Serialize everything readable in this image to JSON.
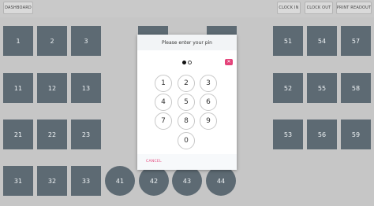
{
  "topbar": {
    "dashboard_label": "DASHBOARD",
    "clock_in_label": "CLOCK IN",
    "clock_out_label": "CLOCK OUT",
    "print_readout_label": "PRINT READOUT"
  },
  "tables": [
    "1",
    "2",
    "3",
    "11",
    "12",
    "13",
    "21",
    "22",
    "23",
    "31",
    "32",
    "33",
    "41",
    "42",
    "43",
    "44",
    "51",
    "54",
    "57",
    "52",
    "55",
    "58",
    "53",
    "56",
    "59"
  ],
  "pin_modal": {
    "title": "Please enter your pin",
    "entered_digits": 1,
    "pin_length": 2,
    "clear_icon": "backspace-x-icon",
    "keys": [
      "1",
      "2",
      "3",
      "4",
      "5",
      "6",
      "7",
      "8",
      "9",
      "0"
    ],
    "cancel_label": "CANCEL"
  },
  "colors": {
    "background": "#c6c6c6",
    "tile": "#5d6a73",
    "accent": "#e4437a"
  }
}
